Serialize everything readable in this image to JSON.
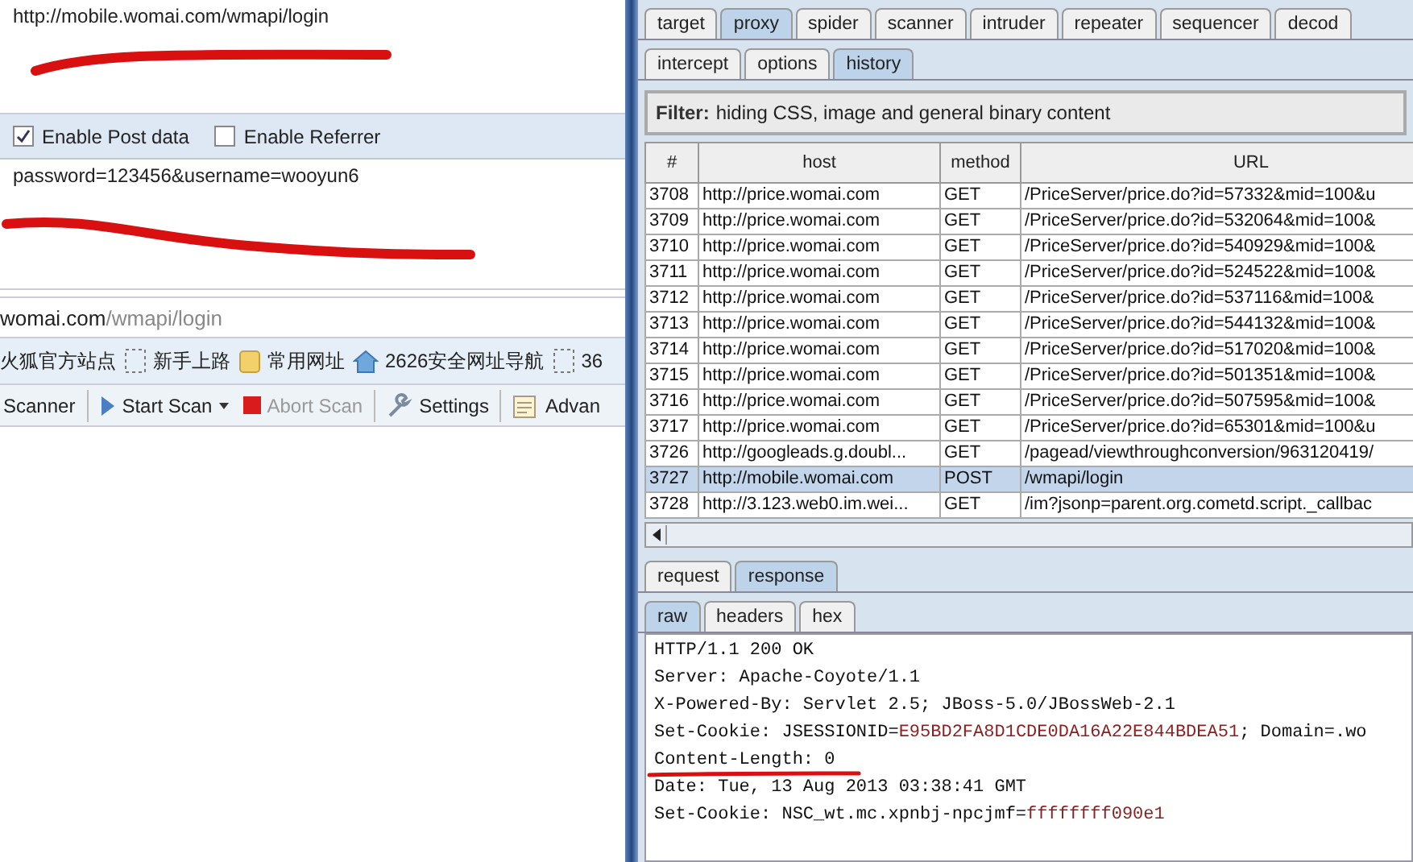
{
  "left_panel": {
    "url_field": {
      "value": "http://mobile.womai.com/wmapi/login"
    },
    "options": [
      {
        "label": "Enable Post data",
        "checked": true
      },
      {
        "label": "Enable Referrer",
        "checked": false
      }
    ],
    "post_data_field": {
      "value": "password=123456&username=wooyun6"
    },
    "address_bar": {
      "domain": "womai.com",
      "path": "/wmapi/login"
    },
    "bookmarks": [
      {
        "kind": "text",
        "label": "火狐官方站点"
      },
      {
        "kind": "page",
        "label": "新手上路"
      },
      {
        "kind": "folder",
        "label": "常用网址"
      },
      {
        "kind": "home",
        "label": "2626安全网址导航"
      },
      {
        "kind": "page",
        "label": "36"
      }
    ],
    "toolbar": [
      {
        "kind": "text",
        "label": "Scanner",
        "disabled": false
      },
      {
        "kind": "start",
        "label": "Start Scan",
        "disabled": false
      },
      {
        "kind": "abort",
        "label": "Abort Scan",
        "disabled": true
      },
      {
        "kind": "settings",
        "label": "Settings",
        "disabled": false
      },
      {
        "kind": "advanced",
        "label": "Advan",
        "disabled": false
      }
    ]
  },
  "tabs": [
    {
      "label": "target",
      "selected": false
    },
    {
      "label": "proxy",
      "selected": true
    },
    {
      "label": "spider",
      "selected": false
    },
    {
      "label": "scanner",
      "selected": false
    },
    {
      "label": "intruder",
      "selected": false
    },
    {
      "label": "repeater",
      "selected": false
    },
    {
      "label": "sequencer",
      "selected": false
    },
    {
      "label": "decod",
      "selected": false
    }
  ],
  "proxy_tabs": [
    {
      "label": "intercept",
      "selected": false
    },
    {
      "label": "options",
      "selected": false
    },
    {
      "label": "history",
      "selected": true
    }
  ],
  "filter": {
    "label": "Filter:",
    "text": "hiding CSS, image and general binary content"
  },
  "table": {
    "columns": [
      "#",
      "host",
      "method",
      "URL"
    ],
    "rows": [
      {
        "cells": [
          "3708",
          "http://price.womai.com",
          "GET",
          "/PriceServer/price.do?id=57332&mid=100&u"
        ],
        "selected": false
      },
      {
        "cells": [
          "3709",
          "http://price.womai.com",
          "GET",
          "/PriceServer/price.do?id=532064&mid=100&"
        ],
        "selected": false
      },
      {
        "cells": [
          "3710",
          "http://price.womai.com",
          "GET",
          "/PriceServer/price.do?id=540929&mid=100&"
        ],
        "selected": false
      },
      {
        "cells": [
          "3711",
          "http://price.womai.com",
          "GET",
          "/PriceServer/price.do?id=524522&mid=100&"
        ],
        "selected": false
      },
      {
        "cells": [
          "3712",
          "http://price.womai.com",
          "GET",
          "/PriceServer/price.do?id=537116&mid=100&"
        ],
        "selected": false
      },
      {
        "cells": [
          "3713",
          "http://price.womai.com",
          "GET",
          "/PriceServer/price.do?id=544132&mid=100&"
        ],
        "selected": false
      },
      {
        "cells": [
          "3714",
          "http://price.womai.com",
          "GET",
          "/PriceServer/price.do?id=517020&mid=100&"
        ],
        "selected": false
      },
      {
        "cells": [
          "3715",
          "http://price.womai.com",
          "GET",
          "/PriceServer/price.do?id=501351&mid=100&"
        ],
        "selected": false
      },
      {
        "cells": [
          "3716",
          "http://price.womai.com",
          "GET",
          "/PriceServer/price.do?id=507595&mid=100&"
        ],
        "selected": false
      },
      {
        "cells": [
          "3717",
          "http://price.womai.com",
          "GET",
          "/PriceServer/price.do?id=65301&mid=100&u"
        ],
        "selected": false
      },
      {
        "cells": [
          "3726",
          "http://googleads.g.doubl...",
          "GET",
          "/pagead/viewthroughconversion/963120419/"
        ],
        "selected": false
      },
      {
        "cells": [
          "3727",
          "http://mobile.womai.com",
          "POST",
          "/wmapi/login"
        ],
        "selected": true
      },
      {
        "cells": [
          "3728",
          "http://3.123.web0.im.wei...",
          "GET",
          "/im?jsonp=parent.org.cometd.script._callbac"
        ],
        "selected": false
      }
    ]
  },
  "message_tabs": [
    {
      "label": "request",
      "selected": false
    },
    {
      "label": "response",
      "selected": true
    }
  ],
  "view_tabs": [
    {
      "label": "raw",
      "selected": true
    },
    {
      "label": "headers",
      "selected": false
    },
    {
      "label": "hex",
      "selected": false
    }
  ],
  "response": [
    [
      {
        "kind": "plain",
        "text": "HTTP/1.1 200 OK"
      }
    ],
    [
      {
        "kind": "plain",
        "text": "Server: Apache-Coyote/1.1"
      }
    ],
    [
      {
        "kind": "plain",
        "text": "X-Powered-By: Servlet 2.5; JBoss-5.0/JBossWeb-2.1"
      }
    ],
    [
      {
        "kind": "plain",
        "text": "Set-Cookie: JSESSIONID="
      },
      {
        "kind": "value",
        "text": "E95BD2FA8D1CDE0DA16A22E844BDEA51"
      },
      {
        "kind": "plain",
        "text": "; Domain=.wo"
      }
    ],
    [
      {
        "kind": "plain",
        "text": "Content-Length: 0"
      }
    ],
    [
      {
        "kind": "plain",
        "text": "Date: Tue, 13 Aug 2013 03:38:41 GMT"
      }
    ],
    [
      {
        "kind": "plain",
        "text": "Set-Cookie: NSC_wt.mc.xpnbj-npcjmf="
      },
      {
        "kind": "value",
        "text": "ffffffff090e1"
      }
    ]
  ]
}
